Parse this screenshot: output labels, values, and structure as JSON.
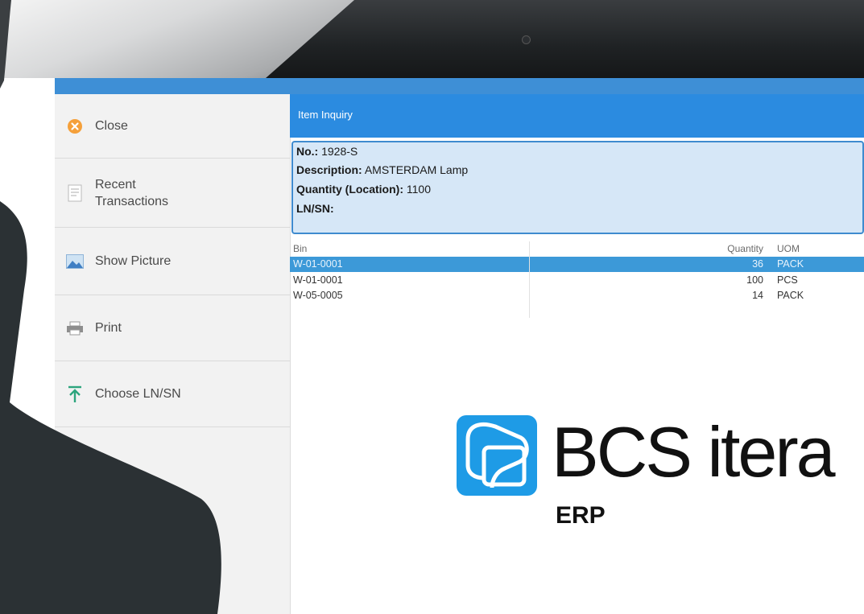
{
  "sidebar": {
    "items": [
      {
        "label": "Close",
        "icon": "close-circle-icon",
        "color": "#f5a03a"
      },
      {
        "label": "Recent Transactions",
        "icon": "document-icon"
      },
      {
        "label": "Show Picture",
        "icon": "picture-icon"
      },
      {
        "label": "Print",
        "icon": "printer-icon"
      },
      {
        "label": "Choose LN/SN",
        "icon": "upload-arrow-icon",
        "color": "#2ca57d"
      }
    ]
  },
  "header": {
    "title": "Item Inquiry"
  },
  "info": {
    "no_label": "No.:",
    "no_value": "1928-S",
    "desc_label": "Description:",
    "desc_value": "AMSTERDAM Lamp",
    "qty_label": "Quantity (Location):",
    "qty_value": "1100",
    "lnsn_label": "LN/SN:"
  },
  "table": {
    "columns": [
      "Bin",
      "Quantity",
      "UOM"
    ],
    "rows": [
      {
        "bin": "W-01-0001",
        "qty": "36",
        "uom": "PACK",
        "selected": true
      },
      {
        "bin": "W-01-0001",
        "qty": "100",
        "uom": "PCS",
        "selected": false
      },
      {
        "bin": "W-05-0005",
        "qty": "14",
        "uom": "PACK",
        "selected": false
      }
    ]
  },
  "logo": {
    "brand": "BCS itera",
    "product": "ERP",
    "color": "#1e9be6"
  },
  "colors": {
    "header": "#2b8be0",
    "selected_row": "#3c99d8",
    "info_bg": "#d6e7f7"
  }
}
